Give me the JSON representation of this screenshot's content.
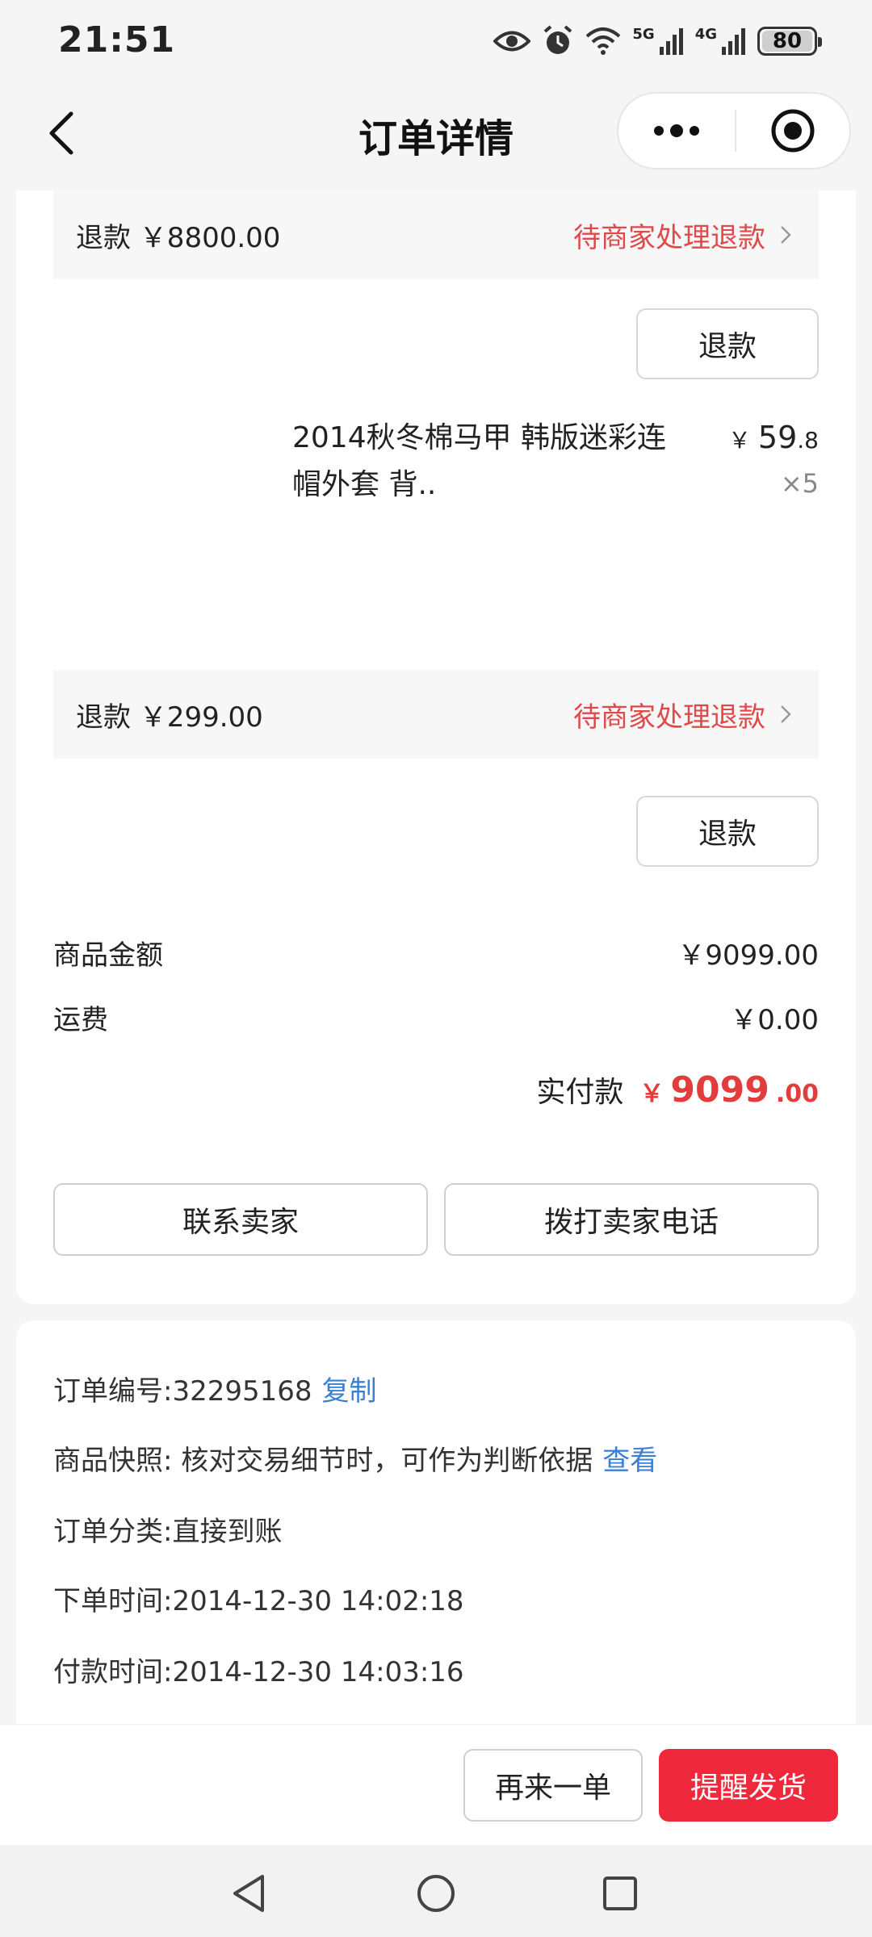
{
  "status_bar": {
    "time": "21:51",
    "network_1": "5G",
    "network_2": "4G",
    "battery": "80",
    "icons": [
      "eye-icon",
      "alarm-icon",
      "wifi-icon",
      "signal-icon",
      "battery-icon"
    ]
  },
  "nav": {
    "title": "订单详情",
    "icons": [
      "back-arrow-icon",
      "more-dots-icon",
      "target-icon"
    ]
  },
  "items": [
    {
      "refund_amount": "退款 ￥8800.00",
      "refund_status": "待商家处理退款",
      "refund_button": "退款"
    },
    {
      "name": "2014秋冬棉马甲 韩版迷彩连帽外套 背..",
      "price_currency": "￥",
      "price_int": "59",
      "price_dec": ".8",
      "quantity": "×5",
      "refund_amount": "退款 ￥299.00",
      "refund_status": "待商家处理退款",
      "refund_button": "退款"
    }
  ],
  "summary": {
    "goods_label": "商品金额",
    "goods_value": "￥9099.00",
    "shipping_label": "运费",
    "shipping_value": "￥0.00",
    "paid_label": "实付款",
    "paid_currency": "￥",
    "paid_int": "9099",
    "paid_dec": ".00"
  },
  "actions": {
    "contact_seller": "联系卖家",
    "call_seller": "拨打卖家电话"
  },
  "info": {
    "order_no_label": "订单编号:32295168",
    "copy_link": "复制",
    "snapshot_label": "商品快照: 核对交易细节时，可作为判断依据",
    "view_link": "查看",
    "category": "订单分类:直接到账",
    "order_time": "下单时间:2014-12-30 14:02:18",
    "pay_time": "付款时间:2014-12-30 14:03:16"
  },
  "bottom": {
    "reorder": "再来一单",
    "remind": "提醒发货"
  },
  "colors": {
    "accent_red": "#f0283c",
    "status_red": "#e04949",
    "link_blue": "#3a7fd4"
  }
}
